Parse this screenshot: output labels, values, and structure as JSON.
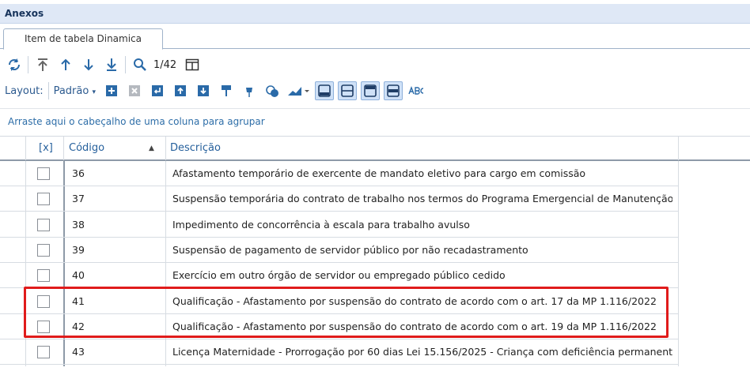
{
  "panel": {
    "title": "Anexos"
  },
  "tab": {
    "label": "Item de tabela Dinamica"
  },
  "toolbar1": {
    "pager": "1/42"
  },
  "toolbar2": {
    "layout_label": "Layout:",
    "layout_value": "Padrão"
  },
  "group_hint": "Arraste aqui o cabeçalho de uma coluna para agrupar",
  "grid": {
    "columns": {
      "select": "[x]",
      "code": "Código",
      "description": "Descrição"
    },
    "rows": [
      {
        "code": "36",
        "description": "Afastamento temporário de exercente de mandato eletivo para cargo em comissão"
      },
      {
        "code": "37",
        "description": "Suspensão temporária do contrato de trabalho nos termos do Programa Emergencial de Manutenção do E..."
      },
      {
        "code": "38",
        "description": "Impedimento de concorrência à escala para trabalho avulso"
      },
      {
        "code": "39",
        "description": "Suspensão de pagamento de servidor público por não recadastramento"
      },
      {
        "code": "40",
        "description": "Exercício em outro órgão de servidor ou empregado público cedido"
      },
      {
        "code": "41",
        "description": "Qualificação - Afastamento por suspensão do contrato de acordo com o art. 17 da MP 1.116/2022"
      },
      {
        "code": "42",
        "description": "Qualificação - Afastamento por suspensão do contrato de acordo com o art. 19 da MP 1.116/2022"
      },
      {
        "code": "43",
        "description": "Licença Maternidade - Prorrogação por 60 dias Lei 15.156/2025 - Criança com deficiência permanente ..."
      }
    ]
  }
}
